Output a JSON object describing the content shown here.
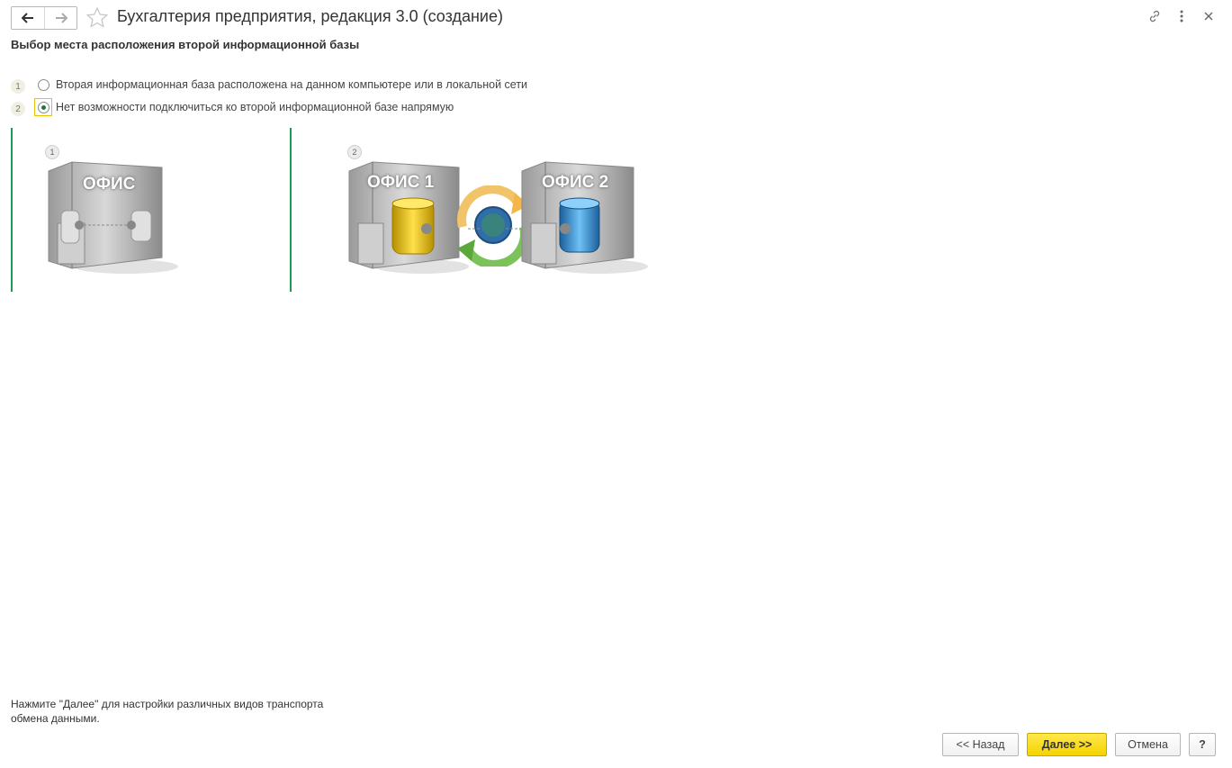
{
  "window": {
    "title": "Бухгалтерия предприятия, редакция 3.0 (создание)"
  },
  "section": {
    "title": "Выбор места расположения второй информационной базы"
  },
  "options": [
    {
      "number": "1",
      "label": "Вторая информационная база расположена на данном компьютере или в локальной сети",
      "selected": false
    },
    {
      "number": "2",
      "label": "Нет возможности подключиться ко второй информационной базе напрямую",
      "selected": true
    }
  ],
  "illustrations": {
    "pane1": {
      "number": "1",
      "building_label": "ОФИС"
    },
    "pane2": {
      "number": "2",
      "building1_label": "ОФИС 1",
      "building2_label": "ОФИС 2"
    }
  },
  "footer": {
    "hint": "Нажмите \"Далее\" для настройки различных видов транспорта обмена данными.",
    "back_label": "<< Назад",
    "next_label": "Далее >>",
    "cancel_label": "Отмена",
    "help_label": "?"
  },
  "colors": {
    "accent_green": "#1f9a55",
    "primary_button": "#f5d300",
    "focus_yellow": "#e6c300",
    "db_yellow": "#e8c000",
    "db_blue": "#2a88d0"
  }
}
